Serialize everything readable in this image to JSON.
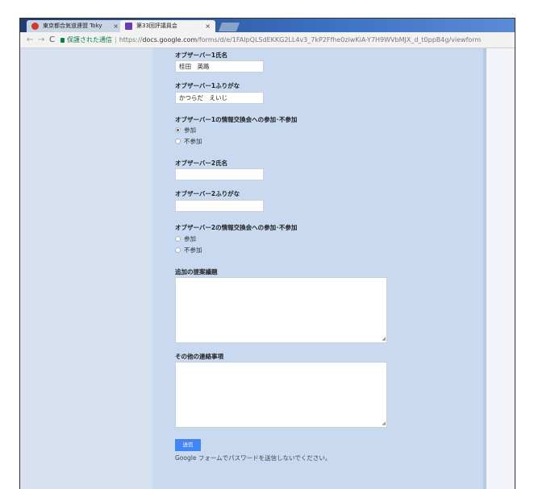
{
  "browser": {
    "tabs": [
      {
        "label": "東京都合気道連盟 Toky"
      },
      {
        "label": "第33回評議員会"
      }
    ],
    "tab_close": "×",
    "nav": {
      "back": "←",
      "forward": "→",
      "reload": "C"
    },
    "address": {
      "secure_label": "保護された通信",
      "separator": "|",
      "url_prefix": "https://",
      "url_host": "docs.google.com",
      "url_path": "/forms/d/e/1FAIpQLSdEKKG2LL4v3_7kP2Ffhe0ziwKiA-Y7H9WVbMJX_d_t0ppB4g/viewform"
    }
  },
  "form": {
    "observer1_name": {
      "title": "オブザーバー1氏名",
      "value": "桂田　英路"
    },
    "observer1_kana": {
      "title": "オブザーバー1ふりがな",
      "value": "かつらだ　えいじ"
    },
    "observer1_meeting": {
      "title": "オブザーバー1の情報交換会への参加･不参加",
      "options": [
        "参加",
        "不参加"
      ],
      "selected": "参加"
    },
    "observer2_name": {
      "title": "オブザーバー2氏名",
      "value": ""
    },
    "observer2_kana": {
      "title": "オブザーバー2ふりがな",
      "value": ""
    },
    "observer2_meeting": {
      "title": "オブザーバー2の情報交換会への参加･不参加",
      "options": [
        "参加",
        "不参加"
      ]
    },
    "proposal": {
      "title": "追加の提案議題"
    },
    "other": {
      "title": "その他の連絡事項"
    },
    "submit_label": "送信",
    "footer_note": "Google フォームでパスワードを送信しないでください。"
  },
  "colors": {
    "accent": "#4285f4",
    "form_background": "#c9daf0",
    "secure_green": "#0b8043"
  }
}
